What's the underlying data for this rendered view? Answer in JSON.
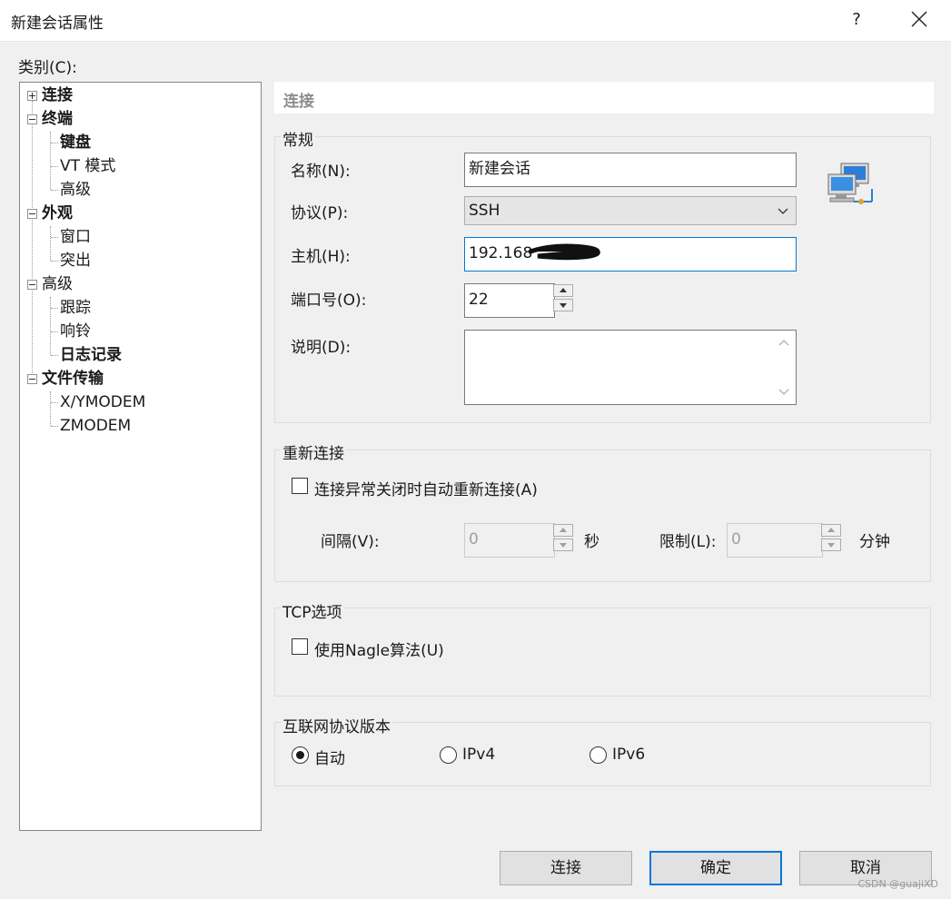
{
  "window": {
    "title": "新建会话属性",
    "help_label": "?"
  },
  "category_label": "类别(C):",
  "tree": [
    {
      "label": "连接",
      "bold": true
    },
    {
      "label": "终端",
      "bold": true
    },
    {
      "label": "键盘",
      "bold": true
    },
    {
      "label": "VT 模式",
      "bold": false
    },
    {
      "label": "高级",
      "bold": false
    },
    {
      "label": "外观",
      "bold": true
    },
    {
      "label": "窗口",
      "bold": false
    },
    {
      "label": "突出",
      "bold": false
    },
    {
      "label": "高级",
      "bold": false
    },
    {
      "label": "跟踪",
      "bold": false
    },
    {
      "label": "响铃",
      "bold": false
    },
    {
      "label": "日志记录",
      "bold": true
    },
    {
      "label": "文件传输",
      "bold": true
    },
    {
      "label": "X/YMODEM",
      "bold": false
    },
    {
      "label": "ZMODEM",
      "bold": false
    }
  ],
  "section_header": "连接",
  "general": {
    "legend": "常规",
    "name_label": "名称(N):",
    "name_value": "新建会话",
    "protocol_label": "协议(P):",
    "protocol_value": "SSH",
    "host_label": "主机(H):",
    "host_value": "192.168",
    "port_label": "端口号(O):",
    "port_value": "22",
    "desc_label": "说明(D):",
    "desc_value": ""
  },
  "reconnect": {
    "legend": "重新连接",
    "auto_label": "连接异常关闭时自动重新连接(A)",
    "auto_checked": false,
    "interval_label": "间隔(V):",
    "interval_value": "0",
    "interval_unit": "秒",
    "limit_label": "限制(L):",
    "limit_value": "0",
    "limit_unit": "分钟"
  },
  "tcp": {
    "legend": "TCP选项",
    "nagle_label": "使用Nagle算法(U)",
    "nagle_checked": false
  },
  "ip_version": {
    "legend": "互联网协议版本",
    "options": [
      "自动",
      "IPv4",
      "IPv6"
    ],
    "selected": "自动"
  },
  "buttons": {
    "connect": "连接",
    "ok": "确定",
    "cancel": "取消"
  },
  "watermark": "CSDN @guajiXD",
  "colors": {
    "accent": "#0078d7",
    "background": "#f0f0f0"
  },
  "icons": {
    "session": "network-computers-icon"
  }
}
